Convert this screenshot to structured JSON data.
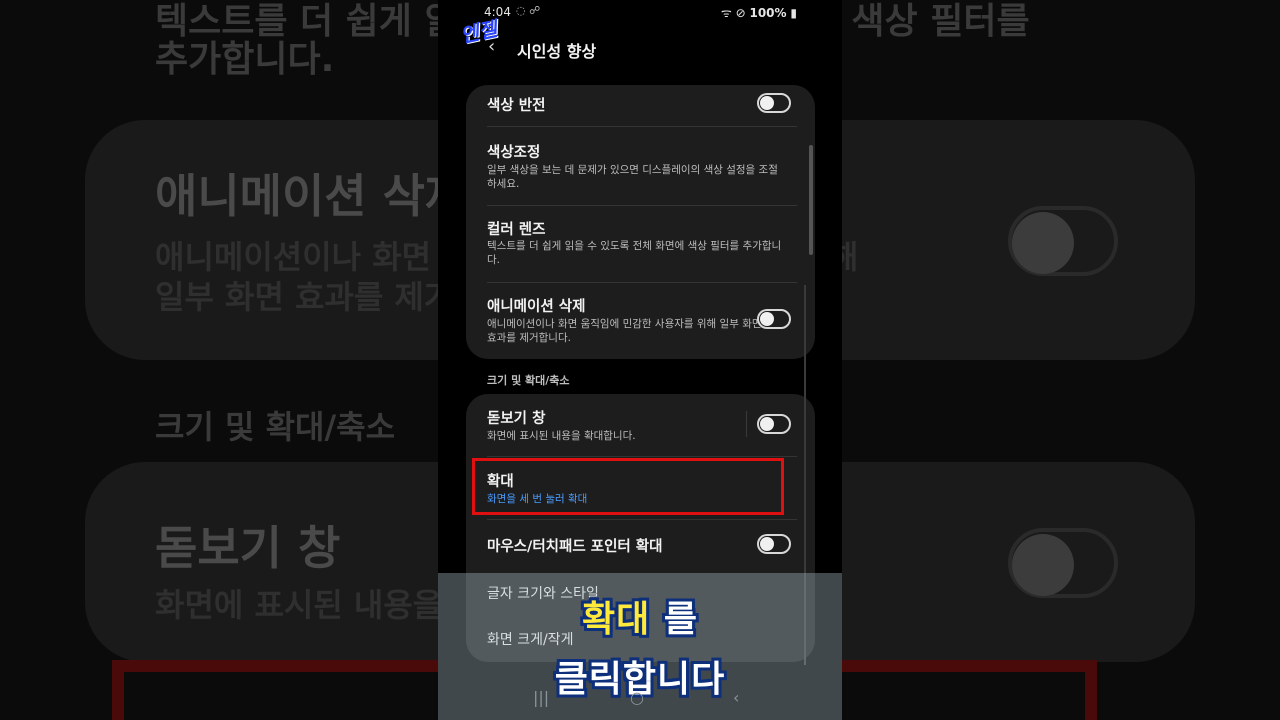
{
  "background": {
    "line1": "텍스트를 더 쉽게 읽을 수 있도록 전체 화면에 색상 필터를",
    "line2": "추가합니다.",
    "anim_title": "애니메이션 삭제",
    "anim_desc1": "애니메이션이나 화면 움직임에 민감한 사용자를 위해",
    "anim_desc2": "일부 화면 효과를 제거합니다.",
    "section": "크기 및 확대/축소",
    "magnifier_title": "돋보기 창",
    "magnifier_desc": "화면에 표시된 내용을 확대합니다."
  },
  "status": {
    "time": "4:04",
    "left_icons": "◌ ☍",
    "right_icons": "ᯤ ⊘",
    "battery": "100%"
  },
  "logo_text": "엔젤",
  "appbar": {
    "back_icon": "‹",
    "title": "시인성 향상"
  },
  "card1": {
    "color_inversion": {
      "label": "색상 반전",
      "on": false
    },
    "color_adjustment": {
      "label": "색상조정",
      "desc": "일부 색상을 보는 데 문제가 있으면 디스플레이의 색상 설정을 조절하세요."
    },
    "color_lens": {
      "label": "컬러 렌즈",
      "desc": "텍스트를 더 쉽게 읽을 수 있도록 전체 화면에 색상 필터를 추가합니다."
    },
    "remove_animations": {
      "label": "애니메이션 삭제",
      "desc": "애니메이션이나 화면 움직임에 민감한 사용자를 위해 일부 화면 효과를 제거합니다.",
      "on": false
    }
  },
  "section_header": "크기 및 확대/축소",
  "card2": {
    "magnifier_window": {
      "label": "돋보기 창",
      "desc": "화면에 표시된 내용을 확대합니다.",
      "on": false
    },
    "magnification": {
      "label": "확대",
      "desc": "화면을 세 번 눌러 확대"
    },
    "pointer_magnify": {
      "label": "마우스/터치패드 포인터 확대",
      "on": false
    },
    "font_size": {
      "label": "글자 크기와 스타일"
    },
    "screen_zoom": {
      "label": "화면 크게/작게"
    }
  },
  "caption": {
    "line1_highlight": "확대",
    "line1_rest": "를",
    "line2": "클릭합니다"
  },
  "navbar": {
    "recents": "|||",
    "home": "○",
    "back": "‹"
  },
  "colors": {
    "accent_blue": "#4a9cff",
    "highlight_red": "#e01010",
    "caption_yellow": "#ffe93b"
  }
}
